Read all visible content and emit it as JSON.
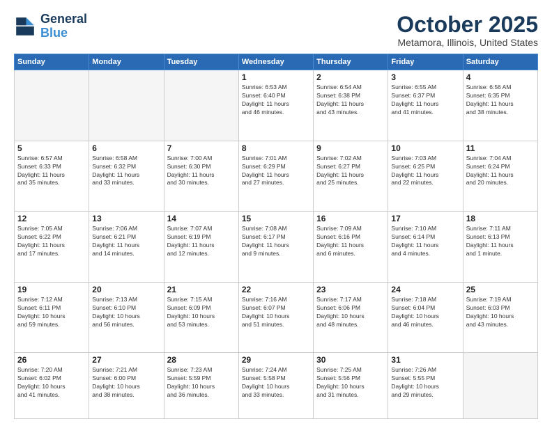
{
  "header": {
    "logo_line1": "General",
    "logo_line2": "Blue",
    "month": "October 2025",
    "location": "Metamora, Illinois, United States"
  },
  "days_of_week": [
    "Sunday",
    "Monday",
    "Tuesday",
    "Wednesday",
    "Thursday",
    "Friday",
    "Saturday"
  ],
  "weeks": [
    [
      {
        "day": "",
        "info": ""
      },
      {
        "day": "",
        "info": ""
      },
      {
        "day": "",
        "info": ""
      },
      {
        "day": "1",
        "info": "Sunrise: 6:53 AM\nSunset: 6:40 PM\nDaylight: 11 hours\nand 46 minutes."
      },
      {
        "day": "2",
        "info": "Sunrise: 6:54 AM\nSunset: 6:38 PM\nDaylight: 11 hours\nand 43 minutes."
      },
      {
        "day": "3",
        "info": "Sunrise: 6:55 AM\nSunset: 6:37 PM\nDaylight: 11 hours\nand 41 minutes."
      },
      {
        "day": "4",
        "info": "Sunrise: 6:56 AM\nSunset: 6:35 PM\nDaylight: 11 hours\nand 38 minutes."
      }
    ],
    [
      {
        "day": "5",
        "info": "Sunrise: 6:57 AM\nSunset: 6:33 PM\nDaylight: 11 hours\nand 35 minutes."
      },
      {
        "day": "6",
        "info": "Sunrise: 6:58 AM\nSunset: 6:32 PM\nDaylight: 11 hours\nand 33 minutes."
      },
      {
        "day": "7",
        "info": "Sunrise: 7:00 AM\nSunset: 6:30 PM\nDaylight: 11 hours\nand 30 minutes."
      },
      {
        "day": "8",
        "info": "Sunrise: 7:01 AM\nSunset: 6:29 PM\nDaylight: 11 hours\nand 27 minutes."
      },
      {
        "day": "9",
        "info": "Sunrise: 7:02 AM\nSunset: 6:27 PM\nDaylight: 11 hours\nand 25 minutes."
      },
      {
        "day": "10",
        "info": "Sunrise: 7:03 AM\nSunset: 6:25 PM\nDaylight: 11 hours\nand 22 minutes."
      },
      {
        "day": "11",
        "info": "Sunrise: 7:04 AM\nSunset: 6:24 PM\nDaylight: 11 hours\nand 20 minutes."
      }
    ],
    [
      {
        "day": "12",
        "info": "Sunrise: 7:05 AM\nSunset: 6:22 PM\nDaylight: 11 hours\nand 17 minutes."
      },
      {
        "day": "13",
        "info": "Sunrise: 7:06 AM\nSunset: 6:21 PM\nDaylight: 11 hours\nand 14 minutes."
      },
      {
        "day": "14",
        "info": "Sunrise: 7:07 AM\nSunset: 6:19 PM\nDaylight: 11 hours\nand 12 minutes."
      },
      {
        "day": "15",
        "info": "Sunrise: 7:08 AM\nSunset: 6:17 PM\nDaylight: 11 hours\nand 9 minutes."
      },
      {
        "day": "16",
        "info": "Sunrise: 7:09 AM\nSunset: 6:16 PM\nDaylight: 11 hours\nand 6 minutes."
      },
      {
        "day": "17",
        "info": "Sunrise: 7:10 AM\nSunset: 6:14 PM\nDaylight: 11 hours\nand 4 minutes."
      },
      {
        "day": "18",
        "info": "Sunrise: 7:11 AM\nSunset: 6:13 PM\nDaylight: 11 hours\nand 1 minute."
      }
    ],
    [
      {
        "day": "19",
        "info": "Sunrise: 7:12 AM\nSunset: 6:11 PM\nDaylight: 10 hours\nand 59 minutes."
      },
      {
        "day": "20",
        "info": "Sunrise: 7:13 AM\nSunset: 6:10 PM\nDaylight: 10 hours\nand 56 minutes."
      },
      {
        "day": "21",
        "info": "Sunrise: 7:15 AM\nSunset: 6:09 PM\nDaylight: 10 hours\nand 53 minutes."
      },
      {
        "day": "22",
        "info": "Sunrise: 7:16 AM\nSunset: 6:07 PM\nDaylight: 10 hours\nand 51 minutes."
      },
      {
        "day": "23",
        "info": "Sunrise: 7:17 AM\nSunset: 6:06 PM\nDaylight: 10 hours\nand 48 minutes."
      },
      {
        "day": "24",
        "info": "Sunrise: 7:18 AM\nSunset: 6:04 PM\nDaylight: 10 hours\nand 46 minutes."
      },
      {
        "day": "25",
        "info": "Sunrise: 7:19 AM\nSunset: 6:03 PM\nDaylight: 10 hours\nand 43 minutes."
      }
    ],
    [
      {
        "day": "26",
        "info": "Sunrise: 7:20 AM\nSunset: 6:02 PM\nDaylight: 10 hours\nand 41 minutes."
      },
      {
        "day": "27",
        "info": "Sunrise: 7:21 AM\nSunset: 6:00 PM\nDaylight: 10 hours\nand 38 minutes."
      },
      {
        "day": "28",
        "info": "Sunrise: 7:23 AM\nSunset: 5:59 PM\nDaylight: 10 hours\nand 36 minutes."
      },
      {
        "day": "29",
        "info": "Sunrise: 7:24 AM\nSunset: 5:58 PM\nDaylight: 10 hours\nand 33 minutes."
      },
      {
        "day": "30",
        "info": "Sunrise: 7:25 AM\nSunset: 5:56 PM\nDaylight: 10 hours\nand 31 minutes."
      },
      {
        "day": "31",
        "info": "Sunrise: 7:26 AM\nSunset: 5:55 PM\nDaylight: 10 hours\nand 29 minutes."
      },
      {
        "day": "",
        "info": ""
      }
    ]
  ]
}
